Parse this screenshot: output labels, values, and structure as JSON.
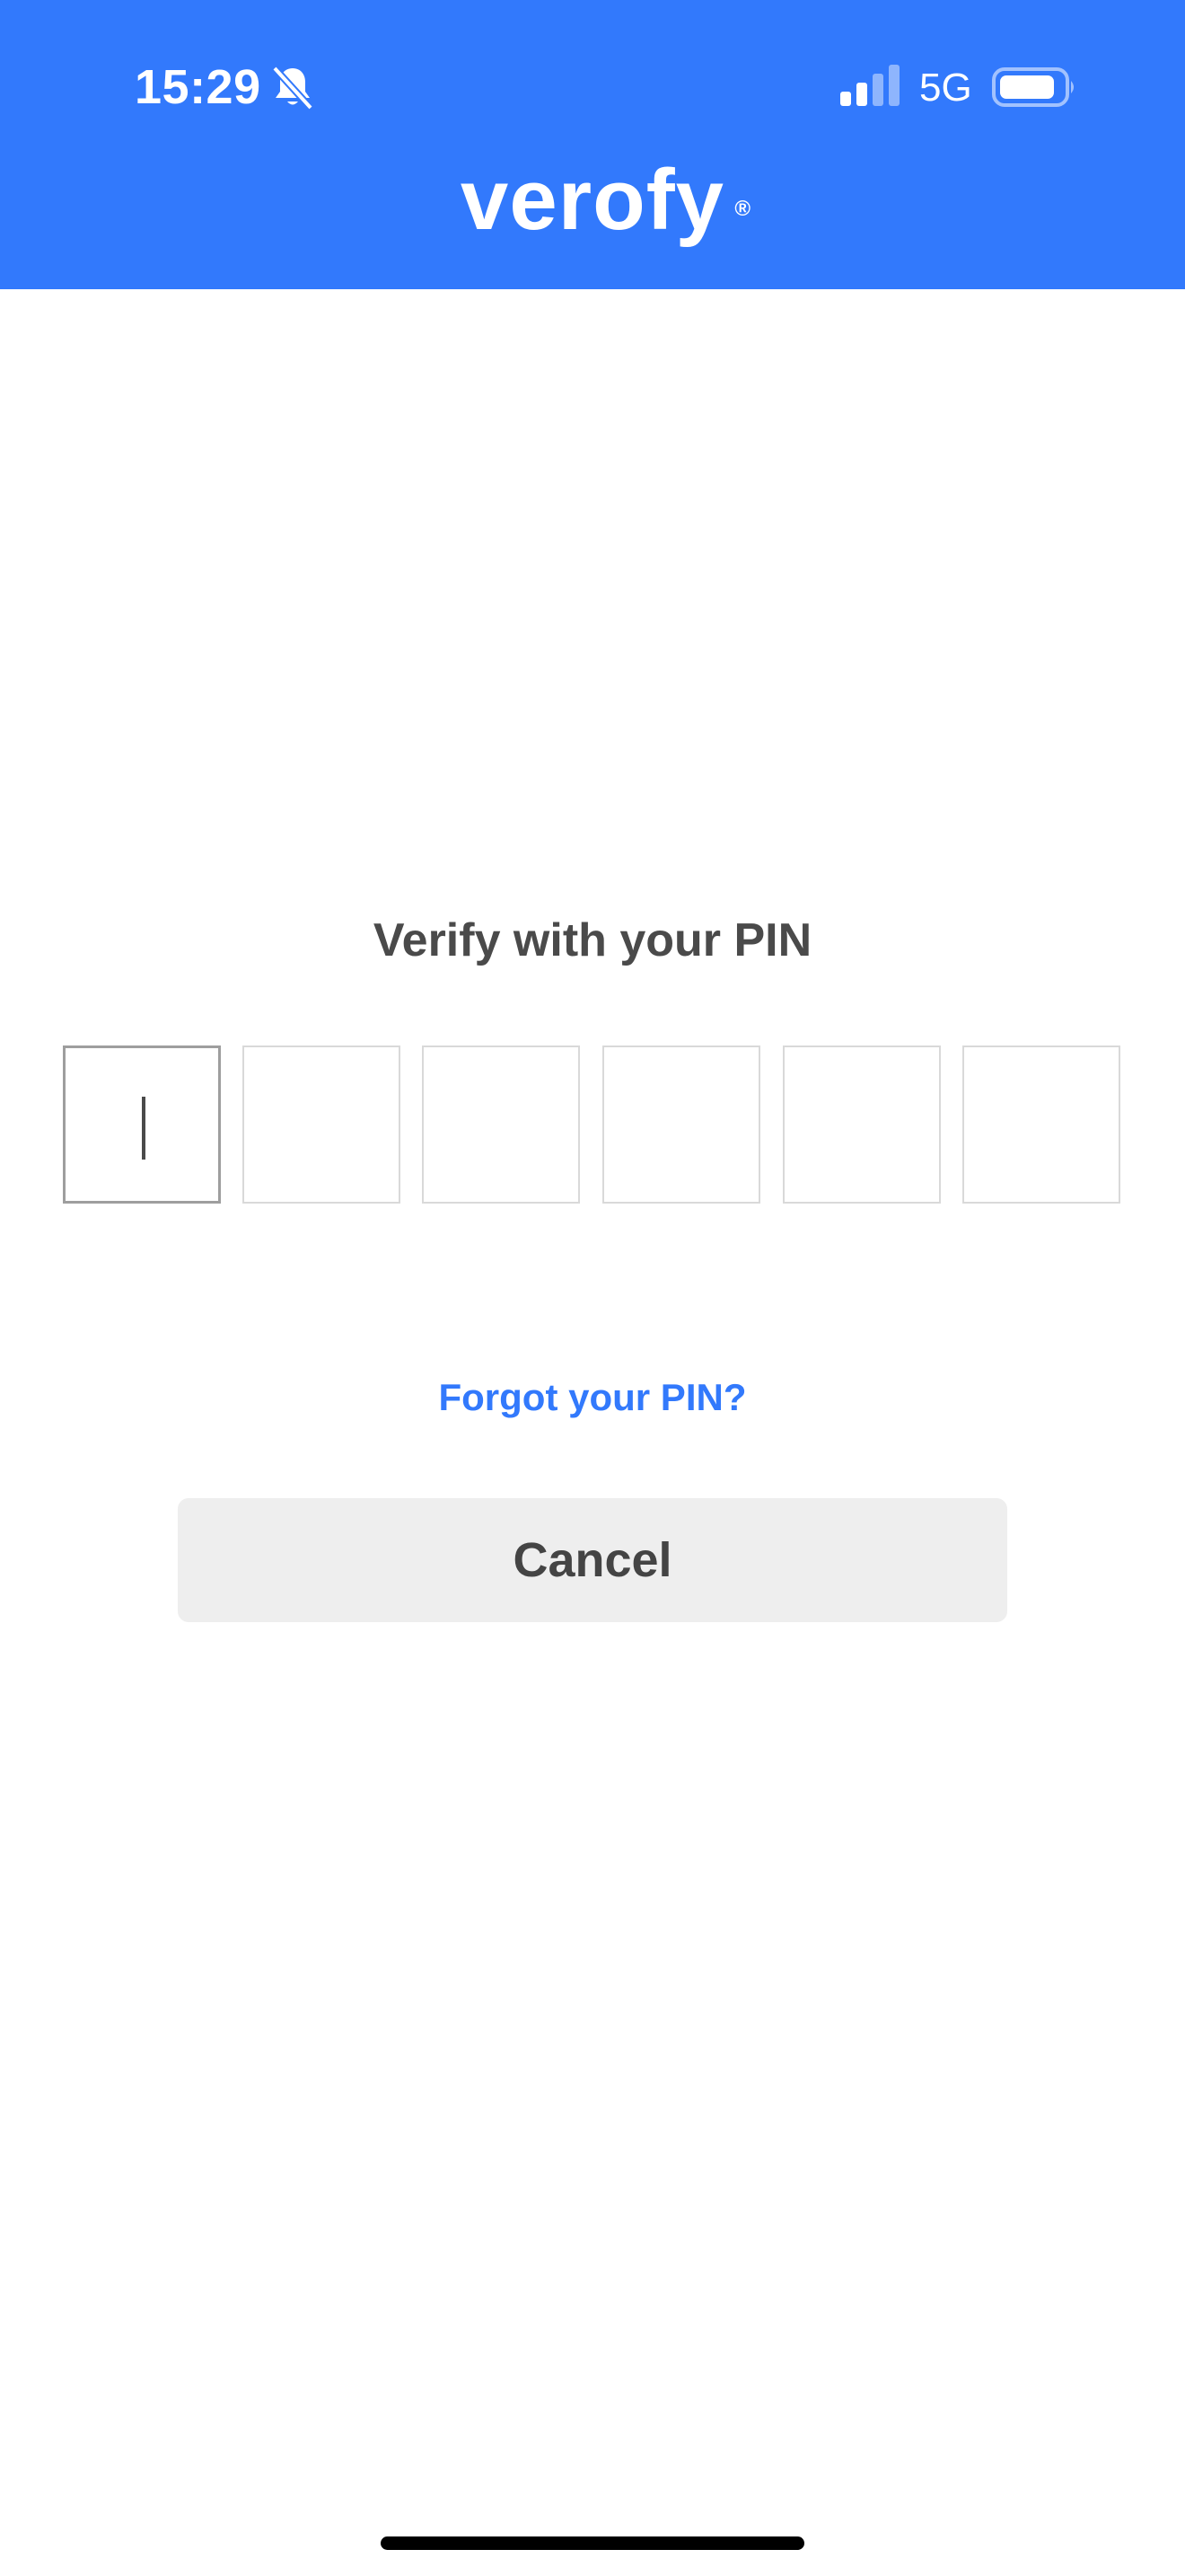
{
  "status_bar": {
    "time": "15:29",
    "network": "5G",
    "icons": [
      "bell-slash-icon",
      "signal-icon",
      "battery-icon"
    ]
  },
  "header": {
    "logo_text": "verofy",
    "logo_mark": "®",
    "background_color": "#3279fc"
  },
  "main": {
    "title": "Verify with your PIN",
    "pin_length": 6,
    "pin_digits": [
      "",
      "",
      "",
      "",
      "",
      ""
    ],
    "forgot_link": "Forgot your PIN?",
    "cancel_label": "Cancel"
  },
  "colors": {
    "accent": "#3279fc",
    "text": "#4a4a4a",
    "button_bg": "#eeeeee"
  }
}
